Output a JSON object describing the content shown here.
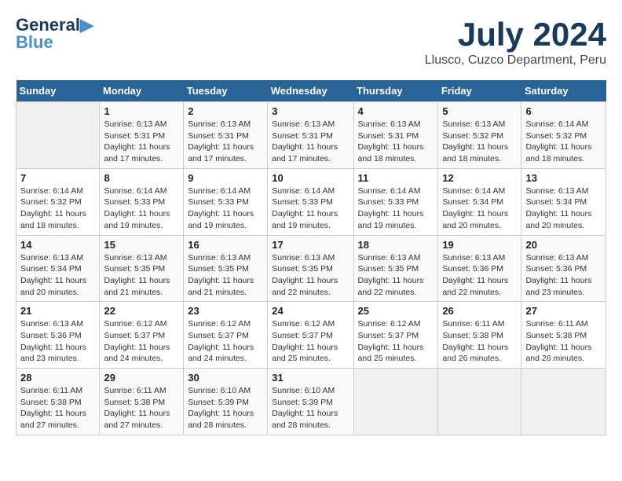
{
  "header": {
    "logo_line1": "General",
    "logo_line2": "Blue",
    "main_title": "July 2024",
    "subtitle": "Llusco, Cuzco Department, Peru"
  },
  "weekdays": [
    "Sunday",
    "Monday",
    "Tuesday",
    "Wednesday",
    "Thursday",
    "Friday",
    "Saturday"
  ],
  "weeks": [
    [
      {
        "day": "",
        "detail": ""
      },
      {
        "day": "1",
        "detail": "Sunrise: 6:13 AM\nSunset: 5:31 PM\nDaylight: 11 hours\nand 17 minutes."
      },
      {
        "day": "2",
        "detail": "Sunrise: 6:13 AM\nSunset: 5:31 PM\nDaylight: 11 hours\nand 17 minutes."
      },
      {
        "day": "3",
        "detail": "Sunrise: 6:13 AM\nSunset: 5:31 PM\nDaylight: 11 hours\nand 17 minutes."
      },
      {
        "day": "4",
        "detail": "Sunrise: 6:13 AM\nSunset: 5:31 PM\nDaylight: 11 hours\nand 18 minutes."
      },
      {
        "day": "5",
        "detail": "Sunrise: 6:13 AM\nSunset: 5:32 PM\nDaylight: 11 hours\nand 18 minutes."
      },
      {
        "day": "6",
        "detail": "Sunrise: 6:14 AM\nSunset: 5:32 PM\nDaylight: 11 hours\nand 18 minutes."
      }
    ],
    [
      {
        "day": "7",
        "detail": "Sunrise: 6:14 AM\nSunset: 5:32 PM\nDaylight: 11 hours\nand 18 minutes."
      },
      {
        "day": "8",
        "detail": "Sunrise: 6:14 AM\nSunset: 5:33 PM\nDaylight: 11 hours\nand 19 minutes."
      },
      {
        "day": "9",
        "detail": "Sunrise: 6:14 AM\nSunset: 5:33 PM\nDaylight: 11 hours\nand 19 minutes."
      },
      {
        "day": "10",
        "detail": "Sunrise: 6:14 AM\nSunset: 5:33 PM\nDaylight: 11 hours\nand 19 minutes."
      },
      {
        "day": "11",
        "detail": "Sunrise: 6:14 AM\nSunset: 5:33 PM\nDaylight: 11 hours\nand 19 minutes."
      },
      {
        "day": "12",
        "detail": "Sunrise: 6:14 AM\nSunset: 5:34 PM\nDaylight: 11 hours\nand 20 minutes."
      },
      {
        "day": "13",
        "detail": "Sunrise: 6:13 AM\nSunset: 5:34 PM\nDaylight: 11 hours\nand 20 minutes."
      }
    ],
    [
      {
        "day": "14",
        "detail": "Sunrise: 6:13 AM\nSunset: 5:34 PM\nDaylight: 11 hours\nand 20 minutes."
      },
      {
        "day": "15",
        "detail": "Sunrise: 6:13 AM\nSunset: 5:35 PM\nDaylight: 11 hours\nand 21 minutes."
      },
      {
        "day": "16",
        "detail": "Sunrise: 6:13 AM\nSunset: 5:35 PM\nDaylight: 11 hours\nand 21 minutes."
      },
      {
        "day": "17",
        "detail": "Sunrise: 6:13 AM\nSunset: 5:35 PM\nDaylight: 11 hours\nand 22 minutes."
      },
      {
        "day": "18",
        "detail": "Sunrise: 6:13 AM\nSunset: 5:35 PM\nDaylight: 11 hours\nand 22 minutes."
      },
      {
        "day": "19",
        "detail": "Sunrise: 6:13 AM\nSunset: 5:36 PM\nDaylight: 11 hours\nand 22 minutes."
      },
      {
        "day": "20",
        "detail": "Sunrise: 6:13 AM\nSunset: 5:36 PM\nDaylight: 11 hours\nand 23 minutes."
      }
    ],
    [
      {
        "day": "21",
        "detail": "Sunrise: 6:13 AM\nSunset: 5:36 PM\nDaylight: 11 hours\nand 23 minutes."
      },
      {
        "day": "22",
        "detail": "Sunrise: 6:12 AM\nSunset: 5:37 PM\nDaylight: 11 hours\nand 24 minutes."
      },
      {
        "day": "23",
        "detail": "Sunrise: 6:12 AM\nSunset: 5:37 PM\nDaylight: 11 hours\nand 24 minutes."
      },
      {
        "day": "24",
        "detail": "Sunrise: 6:12 AM\nSunset: 5:37 PM\nDaylight: 11 hours\nand 25 minutes."
      },
      {
        "day": "25",
        "detail": "Sunrise: 6:12 AM\nSunset: 5:37 PM\nDaylight: 11 hours\nand 25 minutes."
      },
      {
        "day": "26",
        "detail": "Sunrise: 6:11 AM\nSunset: 5:38 PM\nDaylight: 11 hours\nand 26 minutes."
      },
      {
        "day": "27",
        "detail": "Sunrise: 6:11 AM\nSunset: 5:38 PM\nDaylight: 11 hours\nand 26 minutes."
      }
    ],
    [
      {
        "day": "28",
        "detail": "Sunrise: 6:11 AM\nSunset: 5:38 PM\nDaylight: 11 hours\nand 27 minutes."
      },
      {
        "day": "29",
        "detail": "Sunrise: 6:11 AM\nSunset: 5:38 PM\nDaylight: 11 hours\nand 27 minutes."
      },
      {
        "day": "30",
        "detail": "Sunrise: 6:10 AM\nSunset: 5:39 PM\nDaylight: 11 hours\nand 28 minutes."
      },
      {
        "day": "31",
        "detail": "Sunrise: 6:10 AM\nSunset: 5:39 PM\nDaylight: 11 hours\nand 28 minutes."
      },
      {
        "day": "",
        "detail": ""
      },
      {
        "day": "",
        "detail": ""
      },
      {
        "day": "",
        "detail": ""
      }
    ]
  ]
}
